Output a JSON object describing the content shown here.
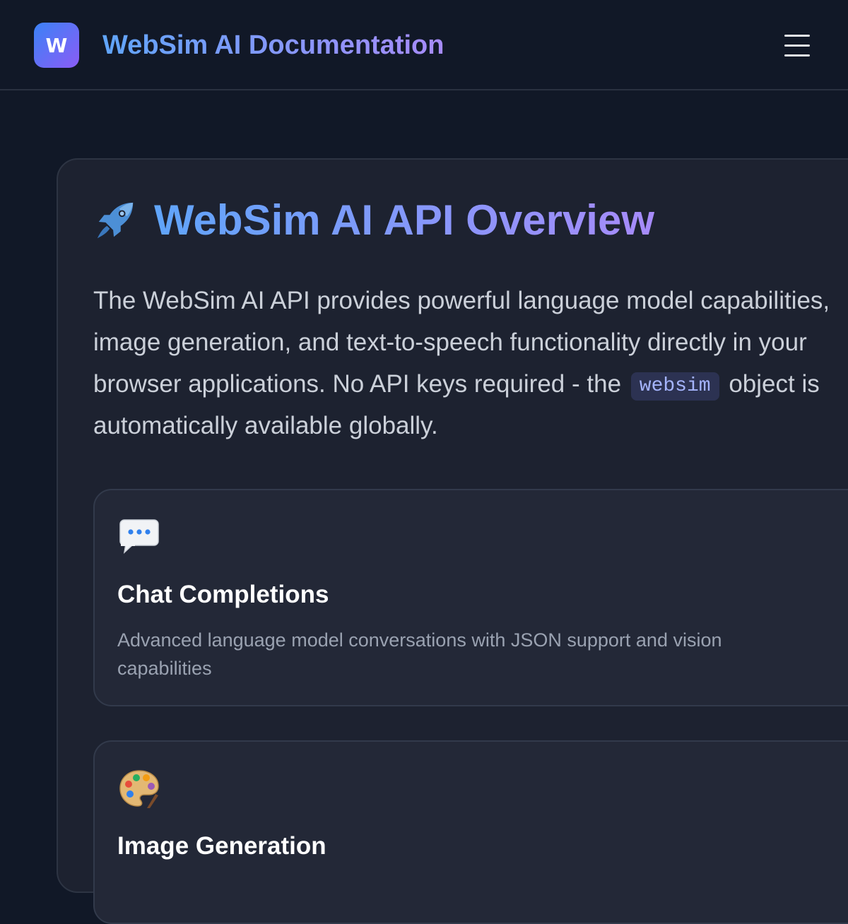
{
  "header": {
    "logo_letter": "W",
    "title": "WebSim AI Documentation",
    "menu_icon": "hamburger-menu-icon"
  },
  "overview": {
    "icon": "rocket-icon",
    "title": "WebSim AI API Overview",
    "intro_before": "The WebSim AI API provides powerful language model capabilities, image generation, and text-to-speech functionality directly in your browser applications. No API keys required - the",
    "intro_code": "websim",
    "intro_after": "object is automatically available globally."
  },
  "features": [
    {
      "icon": "speech-bubble-icon",
      "title": "Chat Completions",
      "description": "Advanced language model conversations with JSON support and vision capabilities"
    },
    {
      "icon": "palette-icon",
      "title": "Image Generation",
      "description": ""
    }
  ],
  "colors": {
    "background": "#111827",
    "card": "#1d2230",
    "accent_start": "#60a5fa",
    "accent_end": "#a78bfa"
  }
}
